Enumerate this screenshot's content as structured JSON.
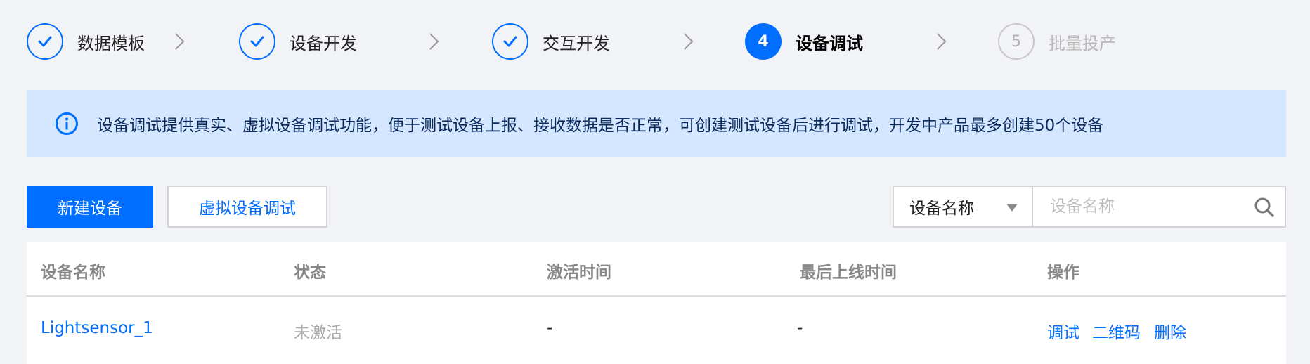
{
  "steps": [
    {
      "label": "数据模板",
      "status": "done"
    },
    {
      "label": "设备开发",
      "status": "done"
    },
    {
      "label": "交互开发",
      "status": "done"
    },
    {
      "label": "设备调试",
      "status": "active",
      "number": "4"
    },
    {
      "label": "批量投产",
      "status": "todo",
      "number": "5"
    }
  ],
  "banner": {
    "text": "设备调试提供真实、虚拟设备调试功能，便于测试设备上报、接收数据是否正常，可创建测试设备后进行调试，开发中产品最多创建50个设备"
  },
  "toolbar": {
    "create_label": "新建设备",
    "virtual_label": "虚拟设备调试",
    "filter_selected": "设备名称",
    "search_placeholder": "设备名称"
  },
  "table": {
    "columns": [
      "设备名称",
      "状态",
      "激活时间",
      "最后上线时间",
      "操作"
    ],
    "rows": [
      {
        "name": "Lightsensor_1",
        "status": "未激活",
        "activated_at": "-",
        "last_online": "-",
        "actions": [
          "调试",
          "二维码",
          "删除"
        ]
      }
    ]
  },
  "colors": {
    "accent": "#006eff",
    "banner_bg": "#d5e7ff",
    "page_bg": "#f2f3f6"
  }
}
